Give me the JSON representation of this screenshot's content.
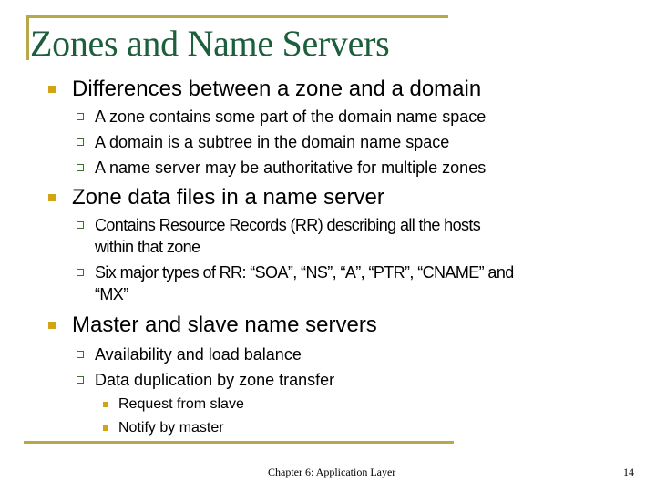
{
  "slide": {
    "title": "Zones and Name Servers",
    "sections": [
      {
        "heading": "Differences between a zone and a domain",
        "items": [
          "A zone contains some part of the domain name space",
          "A domain is a subtree in the domain name space",
          "A name server may be authoritative for multiple zones"
        ]
      },
      {
        "heading": "Zone data files in a name server",
        "items": [
          {
            "line1": "Contains Resource Records (RR) describing all the hosts",
            "line2": "within that zone"
          },
          {
            "line1": "Six major types of RR: “SOA”, “NS”, “A”, “PTR”, “CNAME” and",
            "line2": "“MX”"
          }
        ]
      },
      {
        "heading": "Master and slave name servers",
        "items": [
          "Availability and load balance",
          "Data duplication by zone transfer"
        ],
        "subitems": [
          "Request from slave",
          "Notify by master"
        ]
      }
    ],
    "footer": "Chapter 6: Application Layer",
    "page_number": "14"
  },
  "colors": {
    "title": "#1d5e3c",
    "frame": "#b8a84a",
    "bullet": "#d4a314",
    "sub_bullet": "#3c6e2c"
  }
}
